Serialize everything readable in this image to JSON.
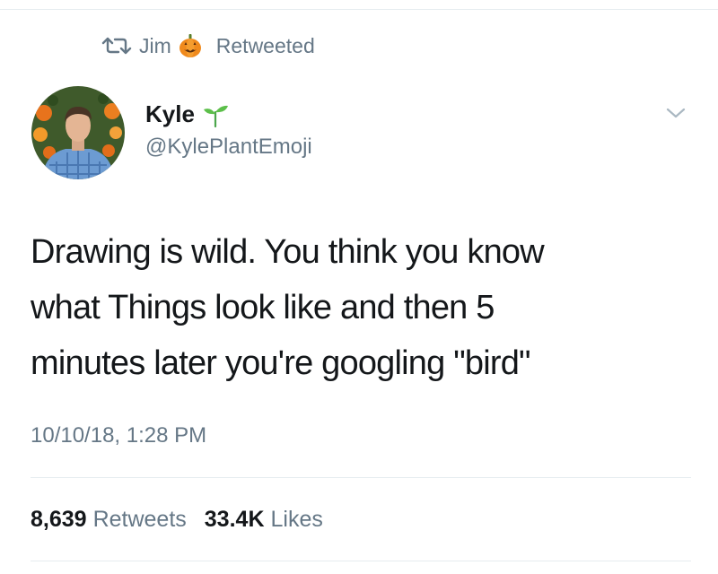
{
  "retweet_banner": {
    "icon": "retweet-icon",
    "name": "Jim",
    "emoji": "pumpkin-icon",
    "label": "Retweeted"
  },
  "author": {
    "name": "Kyle",
    "emoji": "seedling-icon",
    "handle": "@KylePlantEmoji"
  },
  "tweet": {
    "text": "Drawing is wild. You think you know\nwhat Things look like and then 5\nminutes later you're googling \"bird\"",
    "timestamp": "10/10/18, 1:28 PM"
  },
  "stats": {
    "retweets_count": "8,639",
    "retweets_label": "Retweets",
    "likes_count": "33.4K",
    "likes_label": "Likes"
  },
  "colors": {
    "primary_text": "#14171a",
    "secondary_text": "#657786",
    "divider": "#e6ecf0"
  }
}
